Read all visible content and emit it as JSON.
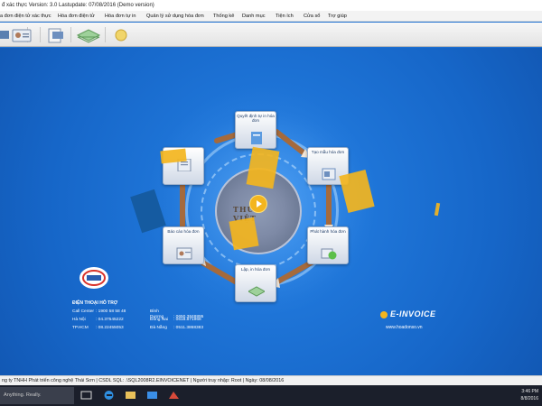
{
  "window": {
    "title": "đ xác thực Version: 3.0 Lastupdate: 07/08/2016 (Demo version)"
  },
  "menu": [
    "a đơn điện tử xác thực",
    "Hóa đơn điện tử",
    "Hóa đơn tự in",
    "Quản lý sử dụng hóa đơn",
    "Thống kê",
    "Danh mục",
    "Tiện ích",
    "Cửa sổ",
    "Trợ giúp"
  ],
  "nodes": {
    "top": {
      "label": "Quyết định tự in hóa đơn"
    },
    "top_right": {
      "label": "Tạo mẫu hóa đơn"
    },
    "bottom_right": {
      "label": "Phát hành hóa đơn"
    },
    "bottom": {
      "label": "Lập, in hóa đơn"
    },
    "bottom_left": {
      "label": "Báo cáo hóa đơn"
    }
  },
  "seal_text": "THUẾ VIỆT",
  "support": {
    "title": "ĐIỆN THOẠI HỖ TRỢ",
    "rows_left": [
      {
        "label": "Call Center",
        "value": ": 1900 58 58 48"
      },
      {
        "label": "Hà Nội",
        "value": ": 04.37545222"
      },
      {
        "label": "TP.HCM",
        "value": ": 08.22455053"
      }
    ],
    "rows_right": [
      {
        "label": "Bình Dương",
        "value": ": 0650.3848895"
      },
      {
        "label": "Đồng Nai",
        "value": ": 0618.871968"
      },
      {
        "label": "Đà Nẵng",
        "value": ": 0511.3868383"
      }
    ]
  },
  "brand": {
    "name": "E-INVOICE",
    "url": "www.hoadonso.vn"
  },
  "statusbar": "ng ty TNHH Phát triển công nghệ Thái Sơn  |  CSDL SQL: .\\SQL2008R2.EINVOICENET  |  Người truy nhập: Root  |  Ngày: 08/08/2016",
  "taskbar": {
    "search_placeholder": "Anything. Really.",
    "time": "3:46 PM",
    "date": "8/8/2016"
  },
  "colors": {
    "accent_yellow": "#f3b51e",
    "background_blue": "#1c6fd1"
  }
}
